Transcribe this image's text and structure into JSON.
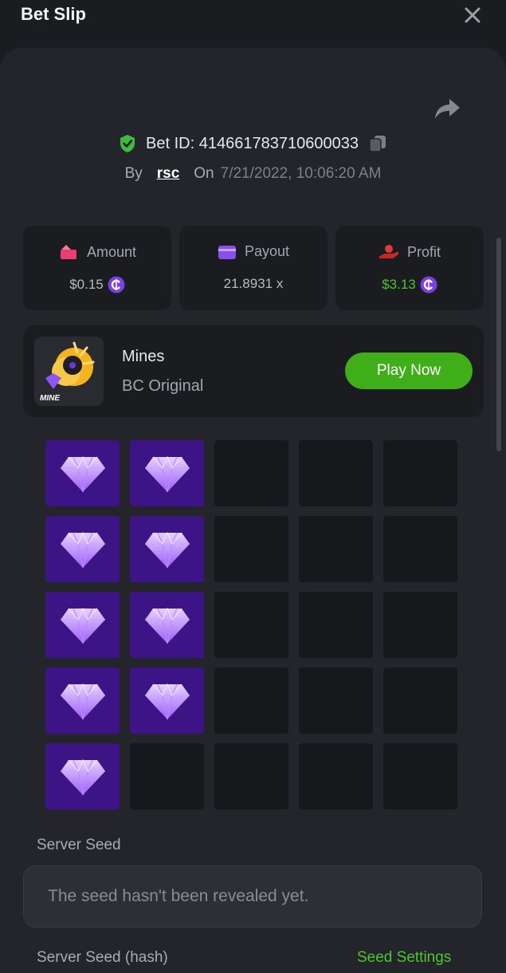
{
  "header": {
    "title": "Bet Slip",
    "close_icon": "close-icon"
  },
  "bet": {
    "id_text": "Bet ID: 414661783710600033",
    "by_label": "By",
    "username": "rsc",
    "on_label": "On",
    "datetime": "7/21/2022, 10:06:20 AM"
  },
  "stats": {
    "amount": {
      "label": "Amount",
      "value": "$0.15"
    },
    "payout": {
      "label": "Payout",
      "value": "21.8931 x"
    },
    "profit": {
      "label": "Profit",
      "value": "$3.13"
    }
  },
  "game": {
    "name": "Mines",
    "subtitle": "BC Original",
    "thumb_label": "MINE",
    "play_label": "Play Now"
  },
  "board": {
    "columns": 5,
    "rows": 5,
    "gem_positions": [
      [
        0,
        0
      ],
      [
        0,
        1
      ],
      [
        1,
        0
      ],
      [
        1,
        1
      ],
      [
        2,
        0
      ],
      [
        2,
        1
      ],
      [
        3,
        0
      ],
      [
        3,
        1
      ],
      [
        4,
        0
      ]
    ]
  },
  "seed": {
    "server_seed_label": "Server Seed",
    "server_seed_value": "The seed hasn't been revealed yet.",
    "hash_label": "Server Seed (hash)",
    "settings_link": "Seed Settings"
  },
  "colors": {
    "accent_green": "#3fae19",
    "profit_green": "#4dc62f",
    "gem_tile": "#3d1486",
    "coin_purple": "#7b3fe4"
  }
}
